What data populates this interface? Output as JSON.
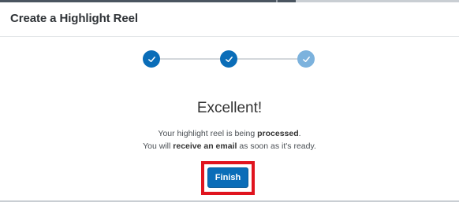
{
  "dialog": {
    "title": "Create a Highlight Reel"
  },
  "stepper": {
    "steps": [
      {
        "icon": "check-icon",
        "state": "complete"
      },
      {
        "icon": "check-icon",
        "state": "complete"
      },
      {
        "icon": "check-icon",
        "state": "current"
      }
    ],
    "colors": {
      "complete": "#0a6db8",
      "current": "#7cb2dd",
      "connector": "#d3d7db"
    }
  },
  "result": {
    "headline": "Excellent!",
    "line1_prefix": "Your highlight reel is being ",
    "line1_bold": "processed",
    "line1_suffix": ".",
    "line2_prefix": "You will ",
    "line2_bold": "receive an email",
    "line2_suffix": " as soon as it's ready."
  },
  "actions": {
    "finish_label": "Finish"
  },
  "colors": {
    "accent": "#0a6db8",
    "highlight_outline": "#e0141e"
  }
}
